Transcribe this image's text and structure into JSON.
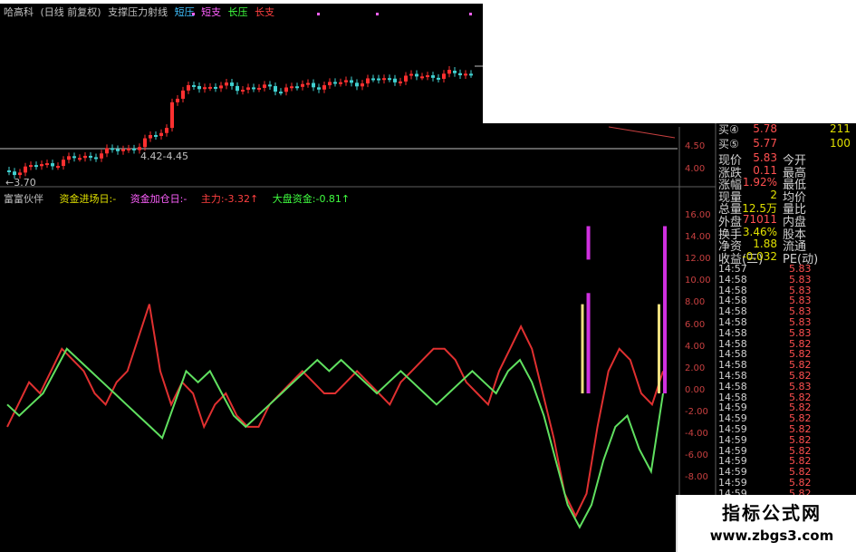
{
  "title_bar": {
    "stock": "哈高科",
    "period": "(日线 前复权)",
    "indicator": "支撑压力射线",
    "lines": [
      "短压",
      "短支",
      "长压",
      "长支"
    ],
    "line_colors": [
      "#40c0ff",
      "#ff60ff",
      "#40ff40",
      "#ff4040"
    ]
  },
  "kline": {
    "low_label": "←3.70",
    "line_label": "4.42-4.45",
    "axis": [
      "4.50",
      "4.00"
    ]
  },
  "indicator_bar": {
    "name": "富富伙伴",
    "items": [
      {
        "label": "资金进场日:-",
        "color": "#e0e000"
      },
      {
        "label": "资金加仓日:-",
        "color": "#ff60ff"
      },
      {
        "label": "主力:-3.32↑",
        "color": "#ff4040"
      },
      {
        "label": "大盘资金:-0.81↑",
        "color": "#40ff40"
      }
    ]
  },
  "indicator_axis": [
    "16.00",
    "14.00",
    "12.00",
    "10.00",
    "8.00",
    "6.00",
    "4.00",
    "2.00",
    "0.00",
    "-2.00",
    "-4.00",
    "-6.00",
    "-8.00"
  ],
  "quote": {
    "buy": [
      {
        "label": "买④",
        "price": "5.78",
        "volume": "211"
      },
      {
        "label": "买⑤",
        "price": "5.77",
        "volume": "100"
      }
    ],
    "rows": [
      {
        "label": "现价",
        "value": "5.83",
        "tail": "今开",
        "color": "#ff5050"
      },
      {
        "label": "涨跌",
        "value": "0.11",
        "tail": "最高",
        "color": "#ff5050"
      },
      {
        "label": "涨幅",
        "value": "1.92%",
        "tail": "最低",
        "color": "#ff5050"
      },
      {
        "label": "现量",
        "value": "2",
        "tail": "均价",
        "color": "#e0e000"
      },
      {
        "label": "总量",
        "value": "12.5万",
        "tail": "量比",
        "color": "#e0e000"
      },
      {
        "label": "外盘",
        "value": "71011",
        "tail": "内盘",
        "color": "#ff5050"
      },
      {
        "label": "换手",
        "value": "3.46%",
        "tail": "股本",
        "color": "#e0e000"
      },
      {
        "label": "净资",
        "value": "1.88",
        "tail": "流通",
        "color": "#e0e000"
      },
      {
        "label": "收益(三)",
        "value": "-0.032",
        "tail": "PE(动)",
        "color": "#e0e000"
      }
    ]
  },
  "ticks": [
    {
      "time": "14:57",
      "price": "5.83"
    },
    {
      "time": "14:58",
      "price": "5.83"
    },
    {
      "time": "14:58",
      "price": "5.83"
    },
    {
      "time": "14:58",
      "price": "5.83"
    },
    {
      "time": "14:58",
      "price": "5.83"
    },
    {
      "time": "14:58",
      "price": "5.83"
    },
    {
      "time": "14:58",
      "price": "5.83"
    },
    {
      "time": "14:58",
      "price": "5.82"
    },
    {
      "time": "14:58",
      "price": "5.82"
    },
    {
      "time": "14:58",
      "price": "5.82"
    },
    {
      "time": "14:58",
      "price": "5.82"
    },
    {
      "time": "14:58",
      "price": "5.83"
    },
    {
      "time": "14:58",
      "price": "5.82"
    },
    {
      "time": "14:59",
      "price": "5.82"
    },
    {
      "time": "14:59",
      "price": "5.82"
    },
    {
      "time": "14:59",
      "price": "5.82"
    },
    {
      "time": "14:59",
      "price": "5.82"
    },
    {
      "time": "14:59",
      "price": "5.82"
    },
    {
      "time": "14:59",
      "price": "5.82"
    },
    {
      "time": "14:59",
      "price": "5.82"
    },
    {
      "time": "14:59",
      "price": "5.82"
    },
    {
      "time": "14:59",
      "price": "5.82"
    }
  ],
  "brand": {
    "name": "指标公式网",
    "url": "www.zbgs3.com"
  },
  "chart_data": {
    "type": "line",
    "ylim": [
      -12,
      16
    ],
    "series": [
      {
        "name": "主力",
        "color": "#e03030",
        "values": [
          -3,
          -1,
          1,
          0,
          2,
          4,
          3,
          2,
          0,
          -1,
          1,
          2,
          5,
          8,
          2,
          -1,
          1,
          0,
          -3,
          -1,
          0,
          -2,
          -3,
          -3,
          -1,
          0,
          1,
          2,
          1,
          0,
          0,
          1,
          2,
          1,
          0,
          -1,
          1,
          2,
          3,
          4,
          4,
          3,
          1,
          0,
          -1,
          2,
          4,
          6,
          4,
          0,
          -4,
          -9,
          -11,
          -9,
          -3,
          2,
          4,
          3,
          0,
          -1,
          2
        ]
      },
      {
        "name": "大盘资金",
        "color": "#60e060",
        "values": [
          -1,
          -2,
          -1,
          0,
          2,
          4,
          3,
          2,
          1,
          0,
          -1,
          -2,
          -3,
          -4,
          -1,
          2,
          1,
          2,
          0,
          -2,
          -3,
          -2,
          -1,
          0,
          1,
          2,
          3,
          2,
          3,
          2,
          1,
          0,
          1,
          2,
          1,
          0,
          -1,
          0,
          1,
          2,
          1,
          0,
          2,
          3,
          1,
          -2,
          -6,
          -10,
          -12,
          -10,
          -6,
          -3,
          -2,
          -5,
          -7,
          0
        ]
      }
    ],
    "bars_magenta": [
      {
        "x": 53,
        "top": 15,
        "bottom": 12
      },
      {
        "x": 53,
        "top": 9,
        "bottom": 0
      },
      {
        "x": 60,
        "top": 15,
        "bottom": 0
      }
    ],
    "bars_yellow": [
      {
        "x": 52.5,
        "top": 8,
        "bottom": 0
      },
      {
        "x": 59.5,
        "top": 8,
        "bottom": 0
      }
    ]
  }
}
